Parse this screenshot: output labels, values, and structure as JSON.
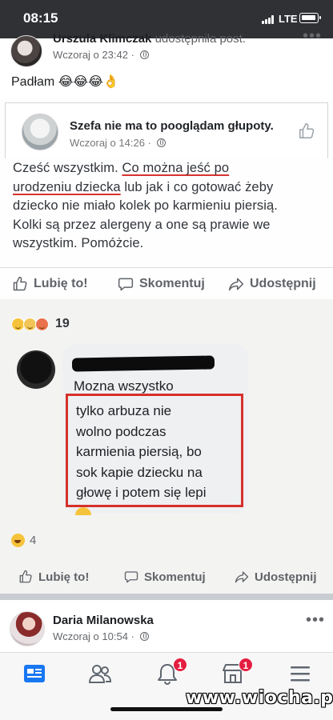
{
  "status_bar": {
    "time": "08:15",
    "network": "LTE"
  },
  "post": {
    "author_name": "Urszula Klimczak",
    "action": "udostępniła post.",
    "timestamp": "Wczoraj o 23:42",
    "privacy_separator": "·",
    "caption": "Padłam 😂😂😂👌"
  },
  "shared_screenshot": {
    "page_name": "Szefa nie ma to pooglądam głupoty.",
    "timestamp": "Wczoraj o 14:26",
    "privacy_separator": "·",
    "body_lines": [
      {
        "plain": "Cześć wszystkim. ",
        "underlined": "Co można jeść po"
      },
      {
        "underlined": "urodzeniu dziecka",
        "plain": " lub jak i co gotować żeby"
      },
      {
        "plain": "dziecko nie miało kolek po karmieniu piersią."
      },
      {
        "plain": "Kolki są przez alergeny a one są prawie we"
      },
      {
        "plain": "wszystkim. Pomóżcie."
      }
    ],
    "actions": {
      "like": "Lubię to!",
      "comment": "Skomentuj",
      "share": "Udostępnij"
    },
    "reaction_count": "19",
    "comment": {
      "first_line": "Mozna wszystko",
      "highlighted_lines": [
        "tylko arbuza nie",
        "wolno podczas",
        "karmienia piersią, bo",
        "sok kapie dziecku na",
        "głowę i potem się lepi"
      ]
    }
  },
  "post_footer": {
    "reaction_count": "4",
    "actions": {
      "like": "Lubię to!",
      "comment": "Skomentuj",
      "share": "Udostępnij"
    }
  },
  "next_post": {
    "author_name": "Daria Milanowska",
    "timestamp": "Wczoraj o 10:54",
    "privacy_separator": "·"
  },
  "tab_bar": {
    "notifications_badge": "1",
    "marketplace_badge": "1"
  },
  "watermark": "www.wiocha.pl",
  "colors": {
    "status_bar": "#2f3135",
    "highlight_box": "#d6302b",
    "badge": "#e41e3f",
    "tab_active": "#1877f2"
  }
}
